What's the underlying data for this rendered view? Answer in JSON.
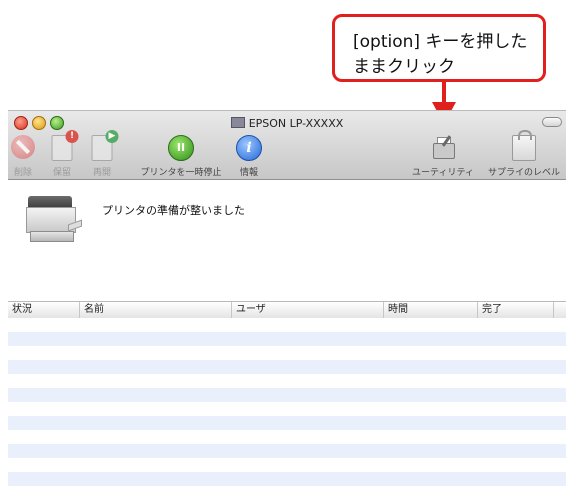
{
  "callout": {
    "line1": "[option] キーを押した",
    "line2": "ままクリック",
    "color": "#e0201c"
  },
  "window": {
    "title": "EPSON LP-XXXXX"
  },
  "toolbar": {
    "delete_label": "削除",
    "hold_label": "保留",
    "resume_label": "再開",
    "pause_printer_label": "プリンタを一時停止",
    "info_label": "情報",
    "utility_label": "ユーティリティ",
    "supply_levels_label": "サプライのレベル"
  },
  "status": {
    "message": "プリンタの準備が整いました"
  },
  "jobs_table": {
    "columns": [
      "状況",
      "名前",
      "ユーザ",
      "時間",
      "完了"
    ],
    "rows": []
  },
  "icons": [
    "delete-icon",
    "hold-icon",
    "resume-icon",
    "pause-icon",
    "info-icon",
    "utility-icon",
    "supply-levels-icon",
    "printer-icon"
  ]
}
